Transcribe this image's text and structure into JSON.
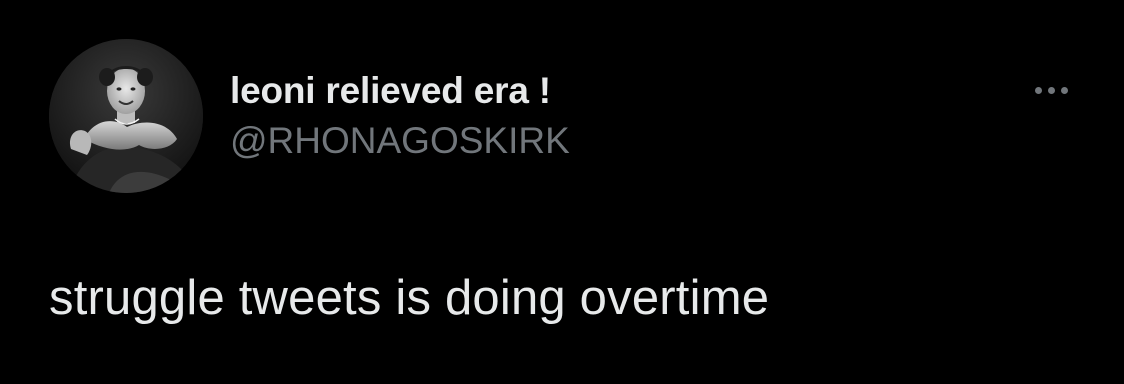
{
  "author": {
    "display_name": "leoni relieved era !",
    "handle": "@RHONAGOSKIRK",
    "avatar": "vintage-black-and-white-photo-of-smiling-woman-in-fur-stole"
  },
  "tweet": {
    "text": "struggle tweets is doing overtime"
  },
  "actions": {
    "more_icon": "more-horizontal-icon"
  },
  "colors": {
    "background": "#000000",
    "primary_text": "#e7e9ea",
    "secondary_text": "#71767b"
  }
}
